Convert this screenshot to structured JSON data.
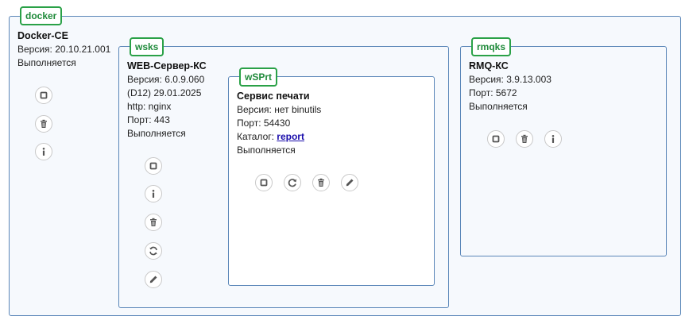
{
  "docker": {
    "tag": "docker",
    "name": "Docker-CE",
    "version": "Версия: 20.10.21.001",
    "status": "Выполняется",
    "actions": [
      "stop-icon",
      "trash-icon",
      "info-icon"
    ]
  },
  "wsks": {
    "tag": "wsks",
    "name": "WEB-Сервер-КС",
    "version": "Версия: 6.0.9.060",
    "build": "(D12) 29.01.2025",
    "http": "http: nginx",
    "port": "Порт: 443",
    "status": "Выполняется",
    "actions": [
      "stop-icon",
      "info-icon",
      "trash-icon",
      "sync-icon",
      "edit-icon"
    ]
  },
  "wsprt": {
    "tag": "wSPrt",
    "name": "Сервис печати",
    "version": "Версия: нет binutils",
    "port": "Порт: 54430",
    "catalog_label": "Каталог: ",
    "catalog_link": "report",
    "status": "Выполняется",
    "actions": [
      "stop-icon",
      "restart-icon",
      "trash-icon",
      "edit-icon"
    ]
  },
  "rmqks": {
    "tag": "rmqks",
    "name": "RMQ-КС",
    "version": "Версия: 3.9.13.003",
    "port": "Порт: 5672",
    "status": "Выполняется",
    "actions": [
      "stop-icon",
      "trash-icon",
      "info-icon"
    ]
  },
  "colors": {
    "border": "#5a86b8",
    "tag_green": "#2aa147",
    "panel_bg": "#f6f9fd",
    "icon": "#555555",
    "link": "#1a0dab"
  }
}
